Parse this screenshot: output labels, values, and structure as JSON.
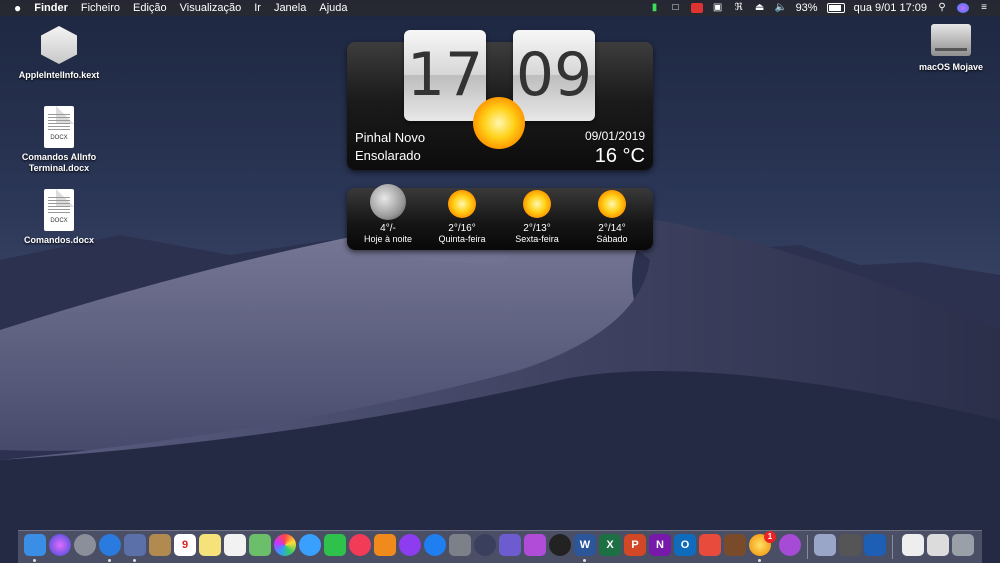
{
  "menubar": {
    "apple": "",
    "app": "Finder",
    "menus": [
      "Ficheiro",
      "Edição",
      "Visualização",
      "Ir",
      "Janela",
      "Ajuda"
    ],
    "battery_percent": "93%",
    "datetime": "qua 9/01  17:09"
  },
  "desktop_icons": {
    "kext": "AppleIntelInfo.kext",
    "doc1": "Comandos AIInfo Terminal.docx",
    "doc2": "Comandos.docx",
    "doc_tag": "DOCX",
    "drive": "macOS Mojave"
  },
  "clock": {
    "hour": "17",
    "minute": "09",
    "city": "Pinhal Novo",
    "condition": "Ensolarado",
    "date": "09/01/2019",
    "temperature": "16 °C"
  },
  "forecast": [
    {
      "temp": "4°/-",
      "day": "Hoje à noite",
      "icon": "moon-icon"
    },
    {
      "temp": "2°/16°",
      "day": "Quinta-feira",
      "icon": "sun-icon"
    },
    {
      "temp": "2°/13°",
      "day": "Sexta-feira",
      "icon": "sun-icon"
    },
    {
      "temp": "2°/14°",
      "day": "Sábado",
      "icon": "sun-icon"
    }
  ],
  "dock": {
    "calendar_day": "9",
    "badge_count": "1",
    "colors": {
      "finder": "#3a8ee6",
      "siri": "#7d4bd0",
      "launchpad": "#8a8f99",
      "safari": "#2a7be0",
      "music": "#f23c57",
      "appstore": "#1f7ef0",
      "word": "#2b579a",
      "excel": "#1d7044",
      "powerpoint": "#d24726",
      "onenote": "#7719aa",
      "outlook": "#0f6cbd",
      "trash": "#9aa0a8"
    }
  }
}
